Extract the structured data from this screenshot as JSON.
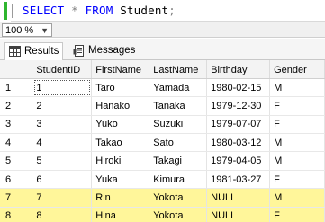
{
  "editor": {
    "tokens": {
      "select": "SELECT",
      "star": "*",
      "from": "FROM",
      "table": "Student",
      "semicolon": ";"
    }
  },
  "zoom": {
    "value": "100 %"
  },
  "tabs": [
    {
      "label": "Results",
      "icon": "grid-icon"
    },
    {
      "label": "Messages",
      "icon": "messages-icon"
    }
  ],
  "grid": {
    "columns": [
      "StudentID",
      "FirstName",
      "LastName",
      "Birthday",
      "Gender"
    ],
    "rows": [
      {
        "n": "1",
        "cells": [
          "1",
          "Taro",
          "Yamada",
          "1980-02-15",
          "M"
        ],
        "highlight": false
      },
      {
        "n": "2",
        "cells": [
          "2",
          "Hanako",
          "Tanaka",
          "1979-12-30",
          "F"
        ],
        "highlight": false
      },
      {
        "n": "3",
        "cells": [
          "3",
          "Yuko",
          "Suzuki",
          "1979-07-07",
          "F"
        ],
        "highlight": false
      },
      {
        "n": "4",
        "cells": [
          "4",
          "Takao",
          "Sato",
          "1980-03-12",
          "M"
        ],
        "highlight": false
      },
      {
        "n": "5",
        "cells": [
          "5",
          "Hiroki",
          "Takagi",
          "1979-04-05",
          "M"
        ],
        "highlight": false
      },
      {
        "n": "6",
        "cells": [
          "6",
          "Yuka",
          "Kimura",
          "1981-03-27",
          "F"
        ],
        "highlight": false
      },
      {
        "n": "7",
        "cells": [
          "7",
          "Rin",
          "Yokota",
          "NULL",
          "M"
        ],
        "highlight": true
      },
      {
        "n": "8",
        "cells": [
          "8",
          "Hina",
          "Yokota",
          "NULL",
          "F"
        ],
        "highlight": true
      }
    ]
  },
  "colors": {
    "keyword": "#0000ff",
    "operator": "#808080",
    "highlight_row": "#fff69a",
    "change_bar": "#2fb52f"
  }
}
